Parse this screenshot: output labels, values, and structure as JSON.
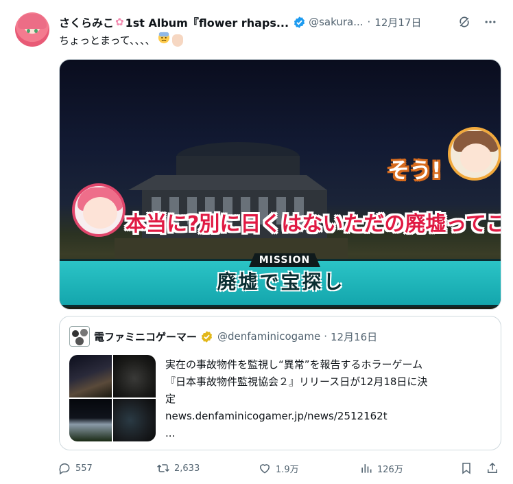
{
  "author": {
    "display_name": "さくらみこ",
    "name_suffix": "1st Album『flower rhaps...",
    "handle": "@sakura...",
    "date": "12月17日"
  },
  "tweet": {
    "text": "ちょっとまって、、、、"
  },
  "media": {
    "caption_main": "本当に?別に日くはないただの廃墟ってこと?",
    "caption_reply": "そう!",
    "mission_label": "MISSION",
    "mission_text": "廃墟で宝探し"
  },
  "quote": {
    "display_name": "電ファミニコゲーマー",
    "handle": "@denfaminicogame",
    "date": "12月16日",
    "text_lines": [
      "実在の事故物件を監視し“異常”を報告するホラーゲーム",
      "『日本事故物件監視協会２』リリース日が12月18日に決",
      "定",
      "news.denfaminicogamer.jp/news/2512162t",
      "..."
    ]
  },
  "actions": {
    "replies": "557",
    "reposts": "2,633",
    "likes": "1.9万",
    "views": "126万"
  },
  "colors": {
    "verified_blue": "#1d9bf0",
    "verified_gold": "#e2b719",
    "secondary_text": "#536471"
  },
  "icons": [
    "verified-icon",
    "grok-icon",
    "more-icon",
    "reply-icon",
    "repost-icon",
    "like-icon",
    "views-icon",
    "bookmark-icon",
    "share-icon"
  ]
}
